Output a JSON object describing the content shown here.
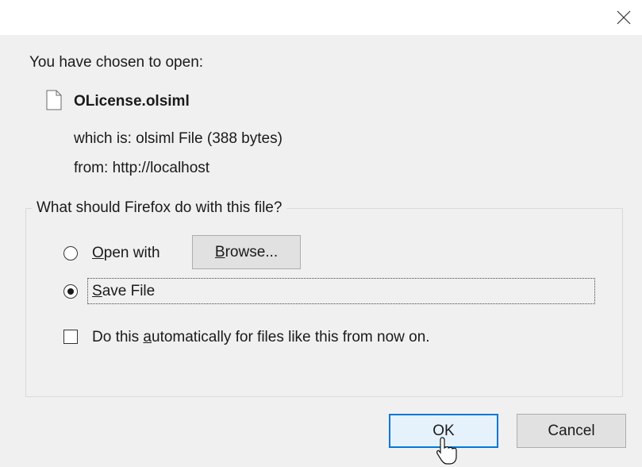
{
  "titlebar": {
    "close_icon": "close-icon"
  },
  "intro_text": "You have chosen to open:",
  "file": {
    "icon": "file-icon",
    "name": "OLicense.olsiml",
    "type_label": "which is:",
    "type_value": "olsiml File (388 bytes)",
    "from_label": "from:",
    "from_value": "http://localhost"
  },
  "action_group": {
    "legend": "What should Firefox do with this file?",
    "open_with": {
      "accesskey": "O",
      "rest": "pen with",
      "selected": false
    },
    "browse_button": {
      "accesskey": "B",
      "rest": "rowse..."
    },
    "save_file": {
      "accesskey": "S",
      "rest": "ave File",
      "selected": true
    },
    "auto_checkbox": {
      "before": "Do this ",
      "accesskey": "a",
      "after": "utomatically for files like this from now on.",
      "checked": false
    }
  },
  "buttons": {
    "ok_label": "OK",
    "cancel_label": "Cancel"
  },
  "colors": {
    "dialog_bg": "#f0f0f0",
    "titlebar_bg": "#ffffff",
    "default_button_border": "#0078d7",
    "default_button_bg": "#e5f1fb",
    "button_bg": "#e1e1e1"
  }
}
